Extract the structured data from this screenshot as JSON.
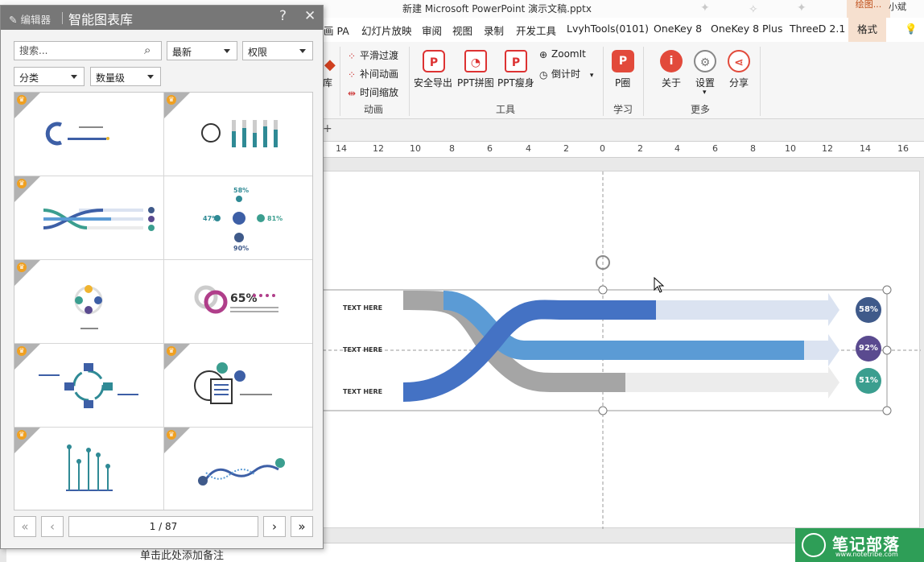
{
  "window": {
    "title": "新建 Microsoft PowerPoint 演示文稿.pptx",
    "context_tab": "绘图...",
    "user": "小斌"
  },
  "tabs": [
    "画 PA",
    "幻灯片放映",
    "审阅",
    "视图",
    "录制",
    "开发工具",
    "LvyhTools(0101)",
    "OneKey 8",
    "OneKey 8 Plus",
    "ThreeD 2.1",
    "格式"
  ],
  "ribbon": {
    "left_partial": "库",
    "anim_items": [
      "平滑过渡",
      "补间动画",
      "时间缩放"
    ],
    "anim_group": "动画",
    "tool_items": [
      "安全导出",
      "PPT拼图",
      "PPT瘦身"
    ],
    "zoom_items": [
      "ZoomIt",
      "倒计时"
    ],
    "tool_group": "工具",
    "study_item": "P圈",
    "study_group": "学习",
    "more_items": [
      "关于",
      "设置",
      "分享"
    ],
    "more_group": "更多"
  },
  "ruler": [
    "14",
    "12",
    "10",
    "8",
    "6",
    "4",
    "2",
    "0",
    "2",
    "4",
    "6",
    "8",
    "10",
    "12",
    "14",
    "16"
  ],
  "slide": {
    "row_labels": [
      "TEXT HERE",
      "TEXT HERE",
      "TEXT HERE"
    ],
    "percents": [
      "58%",
      "92%",
      "51%"
    ],
    "colors": {
      "blue": "#4472c4",
      "lightblue": "#5b9bd5",
      "gray": "#a5a5a5",
      "pale": "#dbe3f1",
      "navy": "#3f5a8a",
      "purple": "#5a4a8f",
      "teal": "#3b9e8f"
    }
  },
  "notes": "单击此处添加备注",
  "watermark": {
    "name": "笔记部落",
    "url": "www.notetribe.com"
  },
  "panel": {
    "edit_label": "编辑器",
    "title": "智能图表库",
    "help": "?",
    "close": "✕",
    "search_placeholder": "搜索...",
    "sort": "最新",
    "permission": "权限",
    "category": "分类",
    "level": "数量级",
    "page": "1 / 87"
  }
}
